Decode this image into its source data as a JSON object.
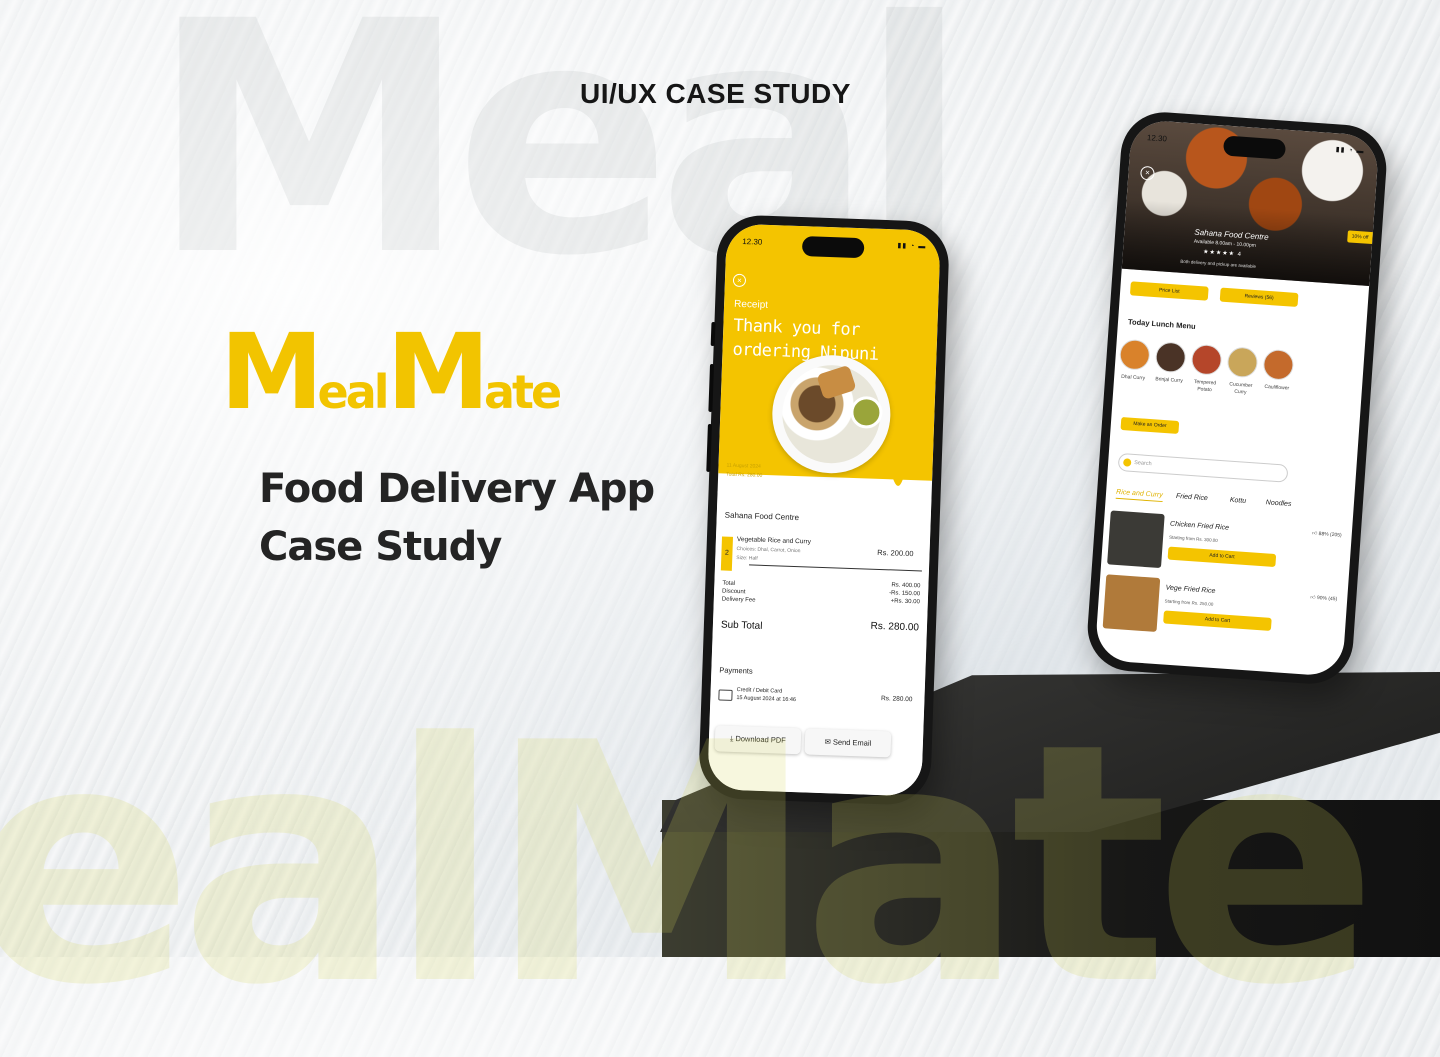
{
  "heading": "UI/UX CASE STUDY",
  "background_words": {
    "top": "Meal",
    "bottom": "ealMate"
  },
  "logo": {
    "m1": "M",
    "part1": "eal",
    "m2": "M",
    "part2": "ate"
  },
  "subtitle": {
    "line1": "Food Delivery App",
    "line2": "Case Study"
  },
  "colors": {
    "accent": "#f4c400",
    "text_dark": "#242424",
    "pedestal": "#1d1d1c"
  },
  "receipt_phone": {
    "time": "12.30",
    "label": "Receipt",
    "thanks": "Thank you for ordering Nipuni",
    "date": "11 August 2024",
    "total_line": "Total Rs. 280.00",
    "shop": "Sahana Food Centre",
    "qty": "2",
    "item_name": "Vegetable Rice and Curry",
    "item_choices": "Choices: Dhal, Carrot, Onion",
    "item_size": "Size: Half",
    "item_price": "Rs. 200.00",
    "total_label": "Total",
    "discount_label": "Discount",
    "delivery_label": "Delivery Fee",
    "total_value": "Rs. 400.00",
    "discount_value": "-Rs. 150.00",
    "delivery_value": "+Rs. 30.00",
    "sub_total_label": "Sub Total",
    "sub_total_value": "Rs. 280.00",
    "payments_label": "Payments",
    "card_label": "Credit / Debit Card",
    "card_date": "15 August 2024 at 16:46",
    "card_value": "Rs. 280.00",
    "download_label": "Download PDF",
    "email_label": "Send Email"
  },
  "menu_phone": {
    "time": "12.30",
    "shop": "Sahana Food Centre",
    "availability": "Available 8.00am - 10.00pm",
    "rating": "★★★★★ 4",
    "note": "Both delivery and pickup are available",
    "offer": "10% off",
    "price_list": "Price List",
    "reviews": "Reviews (56)",
    "today_title": "Today Lunch Menu",
    "dishes": [
      {
        "name": "Dhal Curry",
        "color": "#d9822b"
      },
      {
        "name": "Brinjal Curry",
        "color": "#4a3326"
      },
      {
        "name": "Tempered Potato",
        "color": "#b5462a"
      },
      {
        "name": "Cucumber Curry",
        "color": "#c9a65a"
      },
      {
        "name": "Cauliflower",
        "color": "#c46a2c"
      }
    ],
    "make_order": "Make an Order",
    "search_placeholder": "Search",
    "tabs": [
      "Rice and Curry",
      "Fried Rice",
      "Kottu",
      "Noodles"
    ],
    "items": [
      {
        "name": "Chicken Fried Rice",
        "like": "88% (205)",
        "from": "Starting from Rs. 300.00",
        "add": "Add to Cart",
        "color": "#3b3a36"
      },
      {
        "name": "Vege Fried Rice",
        "like": "90% (45)",
        "from": "Starting from Rs. 250.00",
        "add": "Add to Cart",
        "color": "#b07a3a"
      }
    ]
  }
}
